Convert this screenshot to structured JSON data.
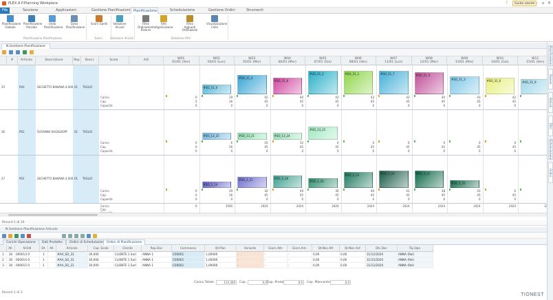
{
  "window": {
    "title": "PLEX A P.Planning Workplace",
    "user_button": "Guida utente"
  },
  "ribbon_tabs": [
    {
      "label": "File"
    },
    {
      "label": "Sessione"
    },
    {
      "label": "Applicazioni"
    },
    {
      "label": "Gestione Pianificazioni"
    },
    {
      "label": "Pianificazione"
    },
    {
      "label": "Schedulazione"
    },
    {
      "label": "Gestione Ordini"
    },
    {
      "label": "Strumenti"
    }
  ],
  "ribbon_buttons": [
    {
      "label": "Pianificazione Globale",
      "icon": "planning-global-icon",
      "color": "#4a90c8"
    },
    {
      "label": "Pianificazione Parziale",
      "icon": "planning-partial-icon",
      "color": "#3d7fb8"
    },
    {
      "label": "Undo Pianificazione",
      "icon": "undo-icon",
      "color": "#5a9bd5"
    },
    {
      "label": "Salva Pianificazione",
      "icon": "save-icon",
      "color": "#6a8fb0"
    },
    {
      "label": "Scorri Gantt",
      "icon": "scroll-gantt-icon",
      "color": "#c97a2a"
    },
    {
      "label": "Selezione Vincoli",
      "icon": "selection-icon",
      "color": "#4aa0c0"
    },
    {
      "label": "Filtro Ordinamento Risorse",
      "icon": "filter-icon",
      "color": "#7a7a7a"
    },
    {
      "label": "Filtri Applicazione",
      "icon": "filter-app-icon",
      "color": "#d4a428"
    },
    {
      "label": "Filtro Aggiunti Ordinazioni",
      "icon": "filter-added-icon",
      "color": "#b88d2a"
    },
    {
      "label": "Visualizzazione Celle",
      "icon": "cells-view-icon",
      "color": "#5c86b0"
    }
  ],
  "ribbon_groups": [
    {
      "label": "Pianificazione Pianificazione"
    },
    {
      "label": "Scorri"
    },
    {
      "label": "Selezione Vincoli"
    },
    {
      "label": "Selezione Filtri"
    }
  ],
  "document_tab": "N.Gestione Pianificazione",
  "grid": {
    "headers": [
      "",
      "#",
      "Articolo",
      "Descrizione",
      "Rep",
      "Descr.",
      "Scala",
      "A/S"
    ],
    "date_headers": [
      {
        "week": "W01",
        "date": "01/01 (Ven)"
      },
      {
        "week": "W02",
        "date": "04/01 (Lun)"
      },
      {
        "week": "W03",
        "date": "05/01 (Mar)"
      },
      {
        "week": "W04",
        "date": "06/01 (Mer)"
      },
      {
        "week": "W05",
        "date": "07/01 (Gio)"
      },
      {
        "week": "W06",
        "date": "08/01 (Ven)"
      },
      {
        "week": "W07",
        "date": "11/01 (Lun)"
      },
      {
        "week": "W08",
        "date": "12/01 (Mar)"
      },
      {
        "week": "W09",
        "date": "13/01 (Mer)"
      },
      {
        "week": "W10",
        "date": "14/01 (Gio)"
      },
      {
        "week": "W11",
        "date": "15/01 (Ven)"
      }
    ],
    "rows": [
      {
        "num": "25",
        "code": "P40",
        "desc": "SECHETTO BANANA 4.000",
        "rep": "01",
        "descr": "TAGLIO",
        "labels": [
          "Carico",
          "Cap.",
          "Capacità"
        ],
        "values": [
          [
            "0",
            "5",
            "0"
          ],
          [
            "19",
            "16",
            "0"
          ],
          [
            "42",
            "45",
            "0"
          ],
          [
            "40",
            "45",
            "0"
          ],
          [
            "42",
            "45",
            "0"
          ],
          [
            "43",
            "45",
            "0"
          ],
          [
            "42",
            "45",
            "0"
          ],
          [
            "40",
            "45",
            "0"
          ],
          [
            "43",
            "45",
            "0"
          ],
          [
            "42",
            "45",
            "0"
          ],
          [
            "0",
            "45",
            "0"
          ]
        ]
      },
      {
        "num": "26",
        "code": "P62",
        "desc": "SUSANNA KUGELKOPF",
        "rep": "01",
        "descr": "TAGLIO",
        "labels": [
          "Carico",
          "Cap.",
          "Capacità"
        ],
        "values": [
          [
            "0",
            "0",
            "0"
          ],
          [
            "6",
            "16",
            "0"
          ],
          [
            "16",
            "45",
            "0"
          ],
          [
            "32",
            "45",
            "0"
          ],
          [
            "0",
            "45",
            "0"
          ],
          [
            "0",
            "45",
            "0"
          ],
          [
            "0",
            "45",
            "0"
          ],
          [
            "0",
            "45",
            "0"
          ],
          [
            "0",
            "45",
            "0"
          ],
          [
            "0",
            "45",
            "0"
          ],
          [
            "0",
            "45",
            "0"
          ]
        ]
      },
      {
        "num": "27",
        "code": "P02",
        "desc": "SECHETTO BANANA 4.000",
        "rep": "01",
        "descr": "TAGLIO",
        "labels": [
          "Carico",
          "Cap.",
          "Capacità"
        ],
        "values": [
          [
            "0",
            "0",
            "0"
          ],
          [
            "19",
            "16",
            "0"
          ],
          [
            "32",
            "45",
            "0"
          ],
          [
            "40",
            "45",
            "0"
          ],
          [
            "36",
            "45",
            "0"
          ],
          [
            "40",
            "45",
            "0"
          ],
          [
            "41",
            "45",
            "0"
          ],
          [
            "38",
            "45",
            "0"
          ],
          [
            "43",
            "45",
            "0"
          ],
          [
            "0",
            "45",
            "0"
          ],
          [
            "0",
            "45",
            "0"
          ]
        ]
      }
    ],
    "totals_labels": [
      "Carico",
      "Cap.",
      "Capacità"
    ],
    "totals": [
      "0",
      "1030",
      "2424",
      "2424",
      "2424",
      "2424",
      "2424",
      "2424",
      "2424",
      "2424",
      "2424"
    ],
    "blocks": [
      {
        "row": 0,
        "col": 1,
        "label": "#SO_31_0",
        "color": "#5bb8d8",
        "h": 0.35
      },
      {
        "row": 0,
        "col": 2,
        "label": "#SO_31_4",
        "color": "#3aa6d6",
        "h": 0.7
      },
      {
        "row": 0,
        "col": 3,
        "label": "#SO_31_8",
        "color": "#d048a0",
        "h": 0.6
      },
      {
        "row": 0,
        "col": 4,
        "label": "#SO_31_2",
        "color": "#2ab0c8",
        "h": 0.85
      },
      {
        "row": 0,
        "col": 5,
        "label": "#SO_31_1",
        "color": "#8fd64a",
        "h": 0.85
      },
      {
        "row": 0,
        "col": 6,
        "label": "#SO_31_7",
        "color": "#45b0d8",
        "h": 0.85
      },
      {
        "row": 0,
        "col": 7,
        "label": "#SO_31_5",
        "color": "#c0509a",
        "h": 0.8
      },
      {
        "row": 0,
        "col": 8,
        "label": "#SO_31_3",
        "color": "#80c8e8",
        "h": 0.65
      },
      {
        "row": 0,
        "col": 9,
        "label": "#SO_31_6",
        "color": "#e8f080",
        "h": 0.6
      },
      {
        "row": 0,
        "col": 10,
        "label": "#SO_31_9",
        "color": "#a0d8e8",
        "h": 0.55
      },
      {
        "row": 1,
        "col": 1,
        "label": "#SO_13_25",
        "color": "#70b8e0",
        "h": 0.25
      },
      {
        "row": 1,
        "col": 2,
        "label": "#SO_13_21",
        "color": "#8ee0b0",
        "h": 0.25
      },
      {
        "row": 1,
        "col": 3,
        "label": "#SO_13_24",
        "color": "#9ae0b8",
        "h": 0.25
      },
      {
        "row": 1,
        "col": 4,
        "label": "#SO_13_22",
        "color": "#a0e8c0",
        "h": 0.45
      },
      {
        "row": 2,
        "col": 1,
        "label": "#SO_3_19",
        "color": "#6060c8",
        "h": 0.2
      },
      {
        "row": 2,
        "col": 2,
        "label": "#SO_3_21",
        "color": "#7070d0",
        "h": 0.35
      },
      {
        "row": 2,
        "col": 3,
        "label": "#SO_3_26",
        "color": "#40a090",
        "h": 0.4
      },
      {
        "row": 2,
        "col": 4,
        "label": "#SO_3_20",
        "color": "#309070",
        "h": 0.3
      },
      {
        "row": 2,
        "col": 5,
        "label": "#SO_3_23",
        "color": "#207a60",
        "h": 0.5
      },
      {
        "row": 2,
        "col": 6,
        "label": "#SO_3_24",
        "color": "#1a5c48",
        "h": 0.55
      },
      {
        "row": 2,
        "col": 7,
        "label": "#SO_3_22",
        "color": "#0e6b4a",
        "h": 0.55
      },
      {
        "row": 2,
        "col": 8,
        "label": "#SO_3_25",
        "color": "#18704e",
        "h": 0.25
      }
    ]
  },
  "right_rail": [
    "Pianificazione",
    "Risorse",
    "Articoli",
    "Filtri",
    "Schedulazione",
    "Ordini"
  ],
  "status_top": "Record 1 di 10",
  "bottom_panel": {
    "title": "N.Gestione Pianificazione Articolo",
    "tabs": [
      "Carichi Operazione",
      "Dati Prodotto",
      "Ordini di Schedulazione",
      "Ordini di Pianificazione"
    ],
    "active_tab": 3,
    "columns": [
      "",
      "All.",
      "N.Odl",
      "Dt.",
      "All.",
      "Articolo",
      "Cap. Scala",
      "Cliente",
      "Rep.Doc",
      "Commessa",
      "Qt.Plan",
      "Variante",
      "Giorn.Attr",
      "Giorn.Ant.",
      "Qt.Nec.Att",
      "Qt.Nec.Ant",
      "Dtc.Doc",
      "Tip.Ope."
    ],
    "rows": [
      [
        "1",
        "30",
        "000013 0",
        "1",
        "",
        "#AA_SO_31",
        "30,000",
        "CLIENTE 1 Sarl",
        "ANNA 1",
        "C00001",
        "1,00000",
        "-",
        "-",
        "-",
        "0,00",
        "0,00",
        "31/12/2020",
        "ANNA (Rel)"
      ],
      [
        "2",
        "30",
        "000014 0",
        "1",
        "",
        "#AA_SO_31",
        "30,000",
        "CLIENTE 1 Sarl",
        "ANNA 1",
        "C00001",
        "1,00000",
        "-",
        "-",
        "-",
        "0,00",
        "0,00",
        "31/12/2020",
        "ANNA (Rel)"
      ],
      [
        "3",
        "30",
        "000015 0",
        "1",
        "",
        "#AA_SO_31",
        "30,000",
        "CLIENTE 1 Sarl",
        "ANNA 1",
        "C00001",
        "1,00000",
        "-",
        "-",
        "-",
        "0,00",
        "0,00",
        "31/12/2020",
        "ANNA (Rel)"
      ]
    ],
    "totals": [
      {
        "label": "Carico Totale",
        "value": "113,300"
      },
      {
        "label": "Cap.",
        "value": "0,0"
      },
      {
        "label": "Cap. Prodotto",
        "value": "0,0"
      },
      {
        "label": "Cap. Mancante",
        "value": "0,0"
      }
    ]
  },
  "status_bottom": "Record 1 di 3",
  "logo": "TIONEST",
  "colors": {
    "accent": "#2a7ab8",
    "active_row": "#cfe3f2",
    "grid_line": "#bfc9d3"
  }
}
